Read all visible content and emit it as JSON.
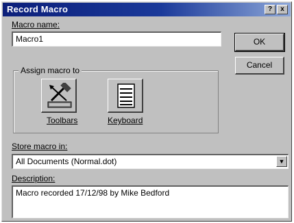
{
  "window": {
    "title": "Record Macro",
    "help_label": "?",
    "close_label": "x"
  },
  "macro_name": {
    "label": "Macro name:",
    "value": "Macro1"
  },
  "buttons": {
    "ok_label": "OK",
    "cancel_label": "Cancel"
  },
  "assign": {
    "legend": "Assign macro to",
    "toolbars_label": "Toolbars",
    "keyboard_label": "Keyboard"
  },
  "store": {
    "label": "Store macro in:",
    "value": "All Documents (Normal.dot)"
  },
  "description": {
    "label": "Description:",
    "value": "Macro recorded 17/12/98 by Mike Bedford"
  },
  "colors": {
    "titlebar_start": "#0c1f7a",
    "titlebar_end": "#8da7d8",
    "face": "#c0c0c0"
  },
  "icons": [
    "toolbars-icon",
    "keyboard-icon",
    "dropdown-arrow-icon"
  ]
}
